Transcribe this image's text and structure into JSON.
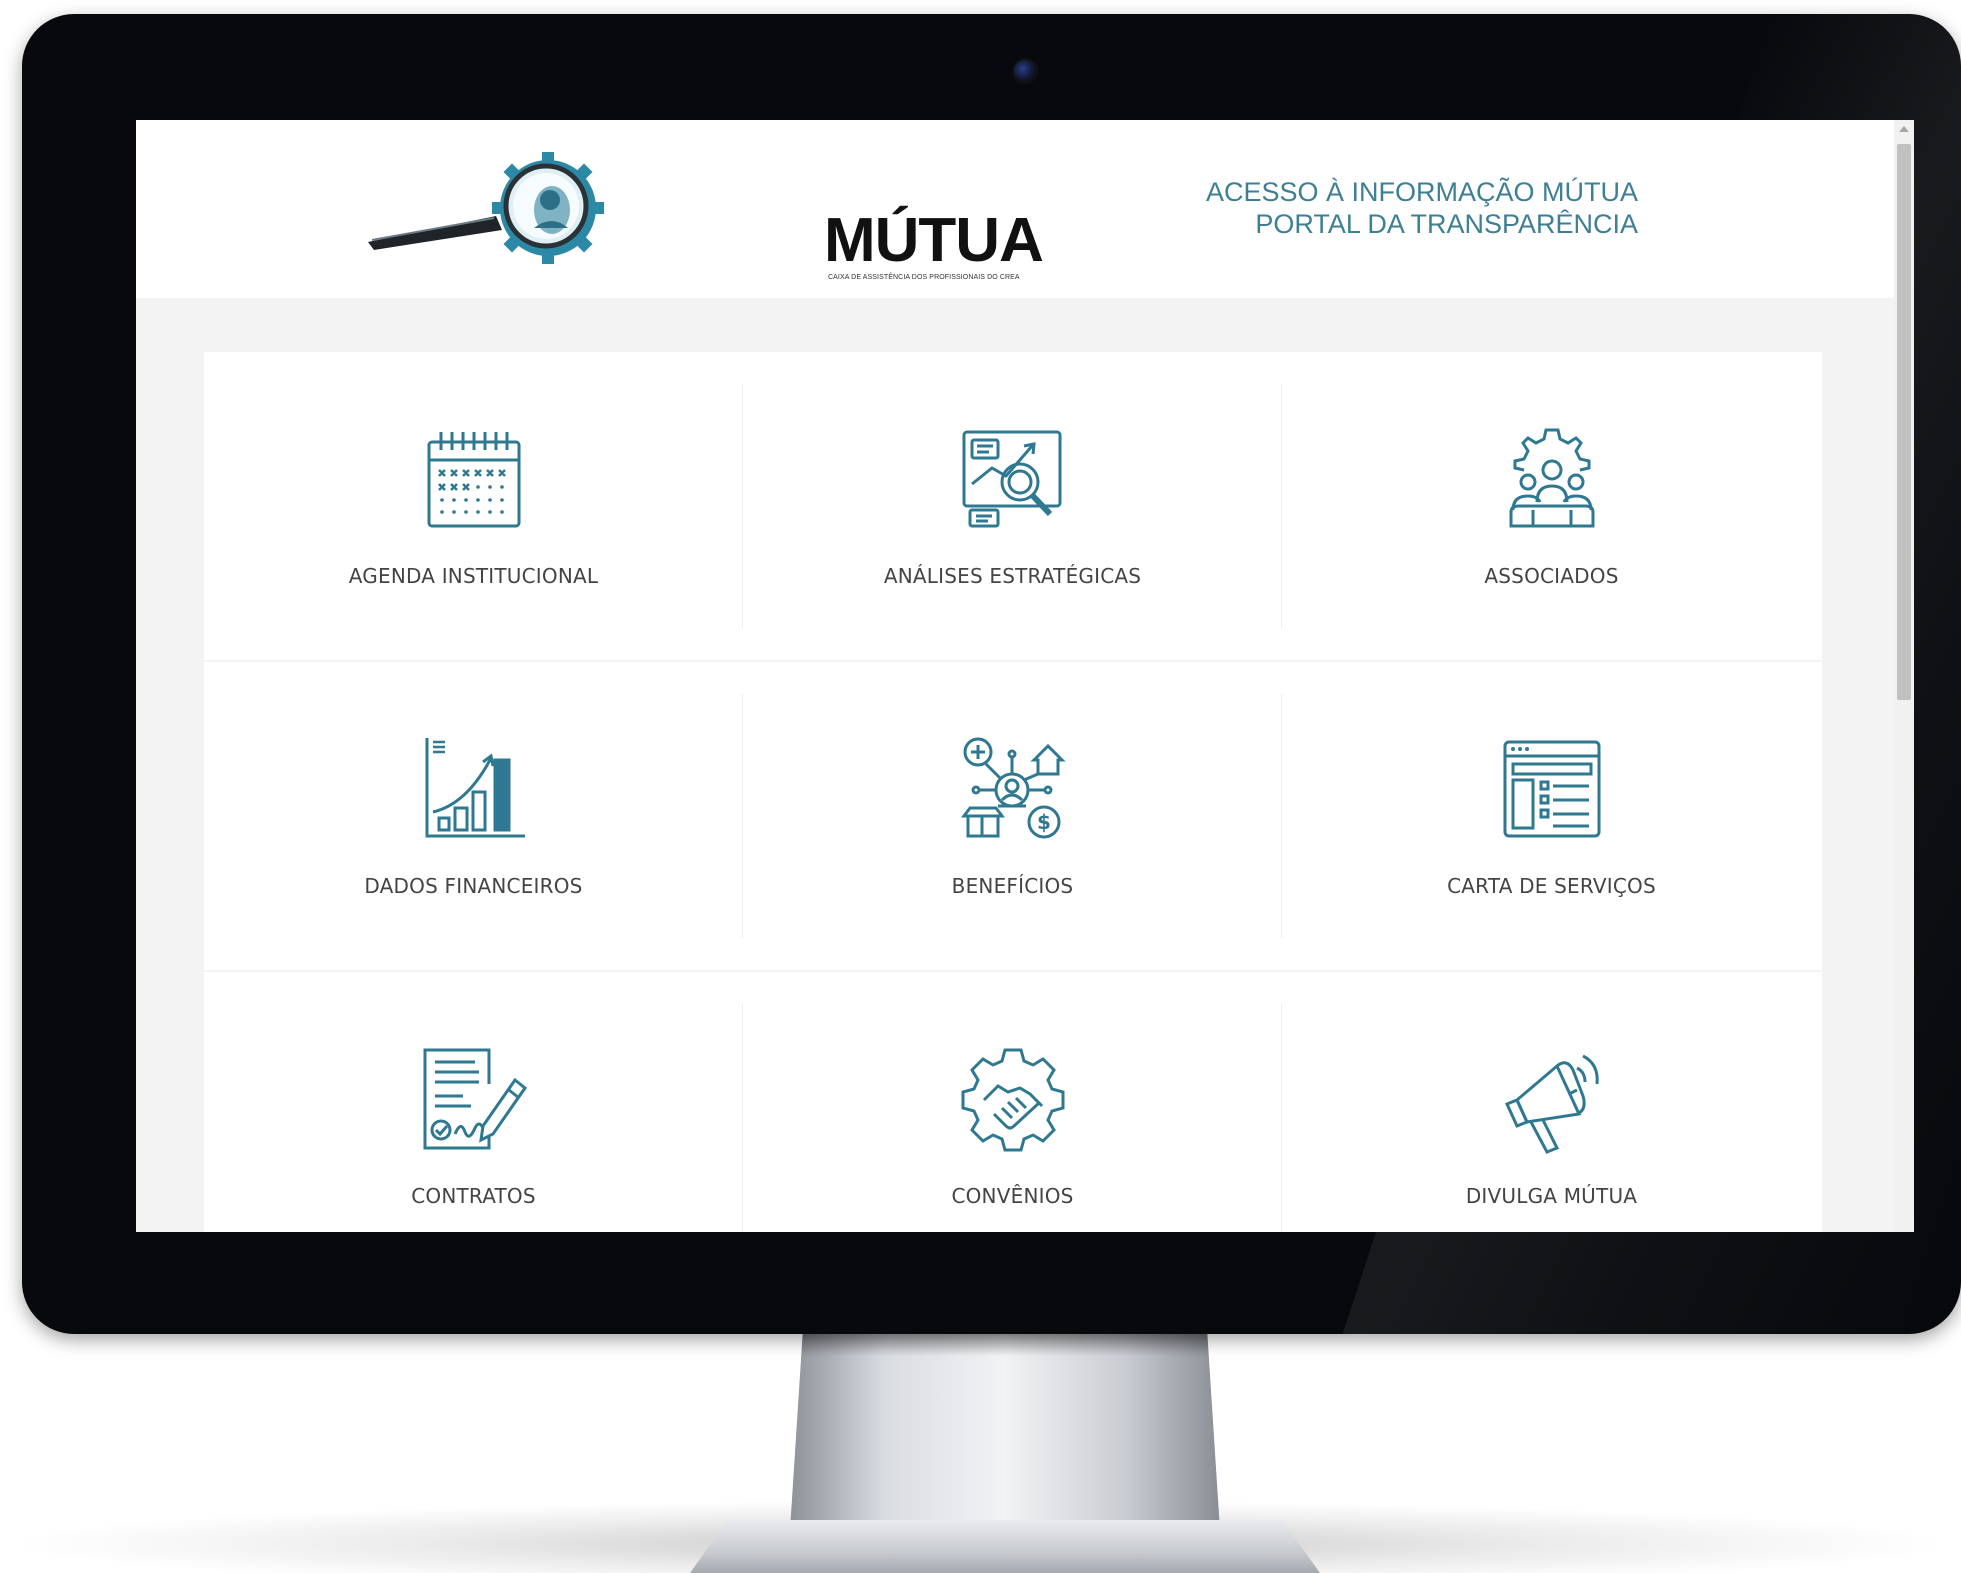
{
  "header": {
    "logo_text": "MÚTUA",
    "logo_subtitle": "CAIXA DE ASSISTÊNCIA DOS PROFISSIONAIS DO CREA",
    "title_line1": "ACESSO À INFORMAÇÃO MÚTUA",
    "title_line2": "PORTAL DA TRANSPARÊNCIA"
  },
  "colors": {
    "accent": "#3d7f93",
    "icon": "#2f7891",
    "text": "#444444"
  },
  "tiles": [
    {
      "label": "AGENDA INSTITUCIONAL",
      "icon": "calendar-icon"
    },
    {
      "label": "ANÁLISES ESTRATÉGICAS",
      "icon": "analytics-icon"
    },
    {
      "label": "ASSOCIADOS",
      "icon": "associates-icon"
    },
    {
      "label": "DADOS FINANCEIROS",
      "icon": "bar-chart-icon"
    },
    {
      "label": "BENEFÍCIOS",
      "icon": "benefits-icon"
    },
    {
      "label": "CARTA DE SERVIÇOS",
      "icon": "services-list-icon"
    },
    {
      "label": "CONTRATOS",
      "icon": "contract-signing-icon"
    },
    {
      "label": "CONVÊNIOS",
      "icon": "handshake-gear-icon"
    },
    {
      "label": "DIVULGA MÚTUA",
      "icon": "megaphone-icon"
    }
  ]
}
